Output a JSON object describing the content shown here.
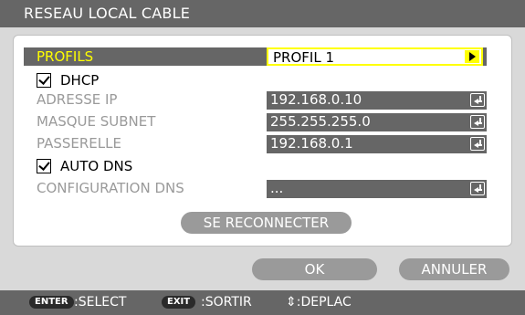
{
  "window": {
    "title": "RESEAU LOCAL CABLE"
  },
  "profile": {
    "label": "PROFILS",
    "value": "PROFIL 1"
  },
  "dhcp": {
    "label": "DHCP",
    "checked": true
  },
  "ip": {
    "label": "ADRESSE IP",
    "value": "192.168.0.10"
  },
  "subnet": {
    "label": "MASQUE SUBNET",
    "value": "255.255.255.0"
  },
  "gateway": {
    "label": "PASSERELLE",
    "value": "192.168.0.1"
  },
  "auto_dns": {
    "label": "AUTO DNS",
    "checked": true
  },
  "dns": {
    "label": "CONFIGURATION DNS",
    "value": "..."
  },
  "buttons": {
    "reconnect": "SE RECONNECTER",
    "ok": "OK",
    "cancel": "ANNULER"
  },
  "footer": {
    "enter_key": "ENTER",
    "enter_text": ":SELECT",
    "exit_key": "EXIT",
    "exit_text": ":SORTIR",
    "move_text": "⇕:DEPLAC"
  },
  "colors": {
    "title_bar": "#666666",
    "highlight": "#ffff00",
    "field_bg": "#666666",
    "button_bg": "#9a9a9a",
    "window_bg": "#d9d9d9"
  },
  "icons": [
    "checkbox-checked-icon",
    "arrow-right-icon",
    "enter-return-icon",
    "updown-arrow-icon"
  ]
}
